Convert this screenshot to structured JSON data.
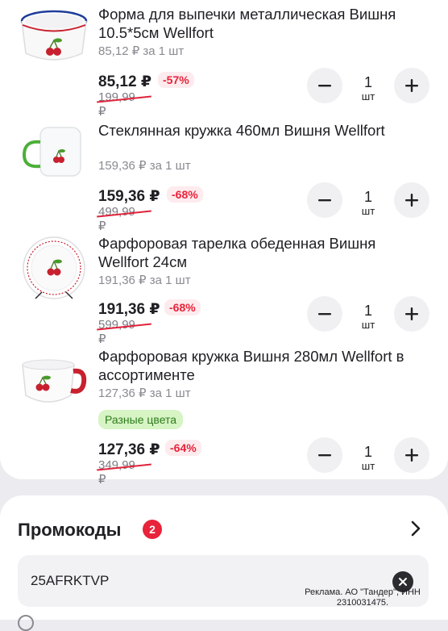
{
  "products": [
    {
      "title": "Форма для выпечки металлическая Вишня 10.5*5см Wellfort",
      "unit_price": "85,12 ₽ за 1 шт",
      "price": "85,12 ₽",
      "discount": "-57%",
      "old_price": "199,99 ₽",
      "quantity": "1",
      "quantity_unit": "шт"
    },
    {
      "title": "Стеклянная кружка 460мл Вишня Wellfort",
      "unit_price": "159,36 ₽ за 1 шт",
      "price": "159,36 ₽",
      "discount": "-68%",
      "old_price": "499,99 ₽",
      "quantity": "1",
      "quantity_unit": "шт"
    },
    {
      "title": "Фарфоровая тарелка обеденная Вишня Wellfort 24см",
      "unit_price": "191,36 ₽ за 1 шт",
      "price": "191,36 ₽",
      "discount": "-68%",
      "old_price": "599,99 ₽",
      "quantity": "1",
      "quantity_unit": "шт"
    },
    {
      "title": "Фарфоровая кружка Вишня 280мл Wellfort в ассортименте",
      "unit_price": "127,36 ₽ за 1 шт",
      "badge": "Разные цвета",
      "price": "127,36 ₽",
      "discount": "-64%",
      "old_price": "349,99 ₽",
      "quantity": "1",
      "quantity_unit": "шт"
    }
  ],
  "buttons": {
    "decrease_icon": "minus-icon",
    "increase_icon": "plus-icon"
  },
  "promo": {
    "title": "Промокоды",
    "count": "2",
    "code": "25AFRKTVP",
    "clear_icon": "close-icon",
    "chevron_icon": "chevron-right-icon"
  },
  "ad_notice": "Реклама. АО \"Тандер\", ИНН 2310031475.",
  "colors": {
    "accent": "#e8233a",
    "discount_bg": "#fdebee",
    "badge_bg": "#d6f4c4",
    "badge_text": "#2f7a1c",
    "page_bg": "#ececf0"
  }
}
